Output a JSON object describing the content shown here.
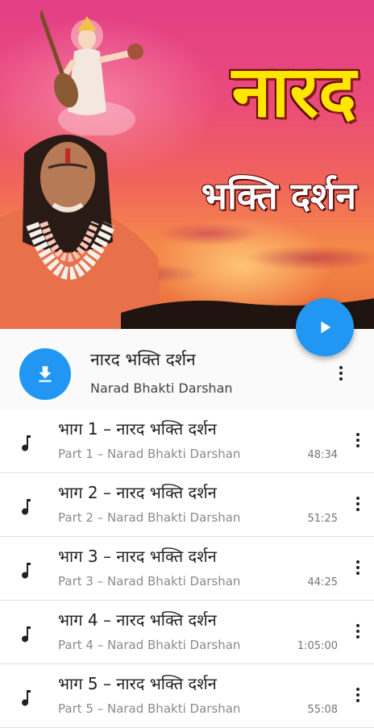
{
  "album": {
    "art_title": "नारद",
    "art_subtitle": "भक्ति दर्शन",
    "title": "नारद भक्ति दर्शन",
    "subtitle": "Narad Bhakti Darshan"
  },
  "colors": {
    "accent": "#2196f3",
    "title_yellow": "#ffe600"
  },
  "icons": {
    "play": "play-icon",
    "download": "download-icon",
    "more": "more-vert-icon",
    "track": "music-note-icon"
  },
  "tracks": [
    {
      "title": "भाग 1 – नारद भक्ति दर्शन",
      "subtitle": "Part 1 – Narad Bhakti Darshan",
      "duration": "48:34"
    },
    {
      "title": "भाग 2 – नारद भक्ति दर्शन",
      "subtitle": "Part 2 – Narad Bhakti Darshan",
      "duration": "51:25"
    },
    {
      "title": "भाग 3 – नारद भक्ति दर्शन",
      "subtitle": "Part 3 – Narad Bhakti Darshan",
      "duration": "44:25"
    },
    {
      "title": "भाग 4 – नारद भक्ति दर्शन",
      "subtitle": "Part 4 – Narad Bhakti Darshan",
      "duration": "1:05:00"
    },
    {
      "title": "भाग 5 – नारद भक्ति दर्शन",
      "subtitle": "Part 5 – Narad Bhakti Darshan",
      "duration": "55:08"
    }
  ]
}
